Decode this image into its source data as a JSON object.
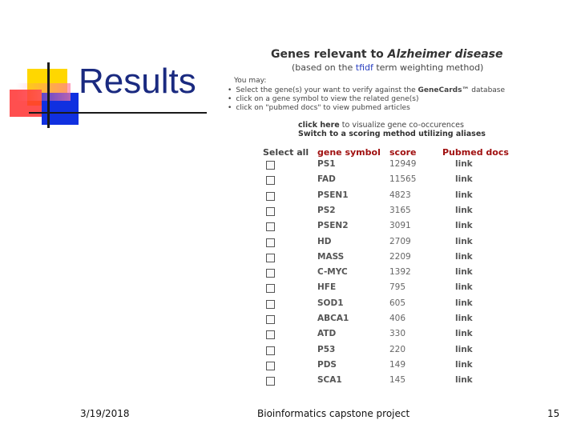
{
  "slide": {
    "title": "Results",
    "footer": {
      "date": "3/19/2018",
      "title": "Bioinformatics capstone project",
      "page": "15"
    }
  },
  "panel": {
    "heading_prefix": "Genes relevant to ",
    "heading_disease": "Alzheimer disease",
    "sub_prefix": "(based on the ",
    "sub_tfidf": "tfidf",
    "sub_suffix": " term weighting method)",
    "you_may": "You may:",
    "instructions": [
      {
        "pre": "Select the gene(s) your want to verify against the ",
        "bold": "GeneCards™",
        "post": " database"
      },
      {
        "pre": "click on a gene symbol to view the related gene(s)",
        "bold": "",
        "post": ""
      },
      {
        "pre": "click on \"pubmed docs\" to view pubmed articles",
        "bold": "",
        "post": ""
      }
    ],
    "visualize": {
      "bold": "click here",
      "rest": " to visualize gene co-occurences"
    },
    "switch": "Switch to a scoring method utilizing aliases",
    "columns": {
      "select": "Select all",
      "symbol": "gene symbol",
      "score": "score",
      "docs": "Pubmed docs"
    },
    "rows": [
      {
        "symbol": "PS1",
        "score": "12949",
        "link": "link"
      },
      {
        "symbol": "FAD",
        "score": "11565",
        "link": "link"
      },
      {
        "symbol": "PSEN1",
        "score": "4823",
        "link": "link"
      },
      {
        "symbol": "PS2",
        "score": "3165",
        "link": "link"
      },
      {
        "symbol": "PSEN2",
        "score": "3091",
        "link": "link"
      },
      {
        "symbol": "HD",
        "score": "2709",
        "link": "link"
      },
      {
        "symbol": "MASS",
        "score": "2209",
        "link": "link"
      },
      {
        "symbol": "C-MYC",
        "score": "1392",
        "link": "link"
      },
      {
        "symbol": "HFE",
        "score": "795",
        "link": "link"
      },
      {
        "symbol": "SOD1",
        "score": "605",
        "link": "link"
      },
      {
        "symbol": "ABCA1",
        "score": "406",
        "link": "link"
      },
      {
        "symbol": "ATD",
        "score": "330",
        "link": "link"
      },
      {
        "symbol": "P53",
        "score": "220",
        "link": "link"
      },
      {
        "symbol": "PDS",
        "score": "149",
        "link": "link"
      },
      {
        "symbol": "SCA1",
        "score": "145",
        "link": "link"
      }
    ]
  },
  "colors": {
    "title": "#1a2a80",
    "header": "#a01010",
    "accent_blue": "#2a40c0"
  }
}
